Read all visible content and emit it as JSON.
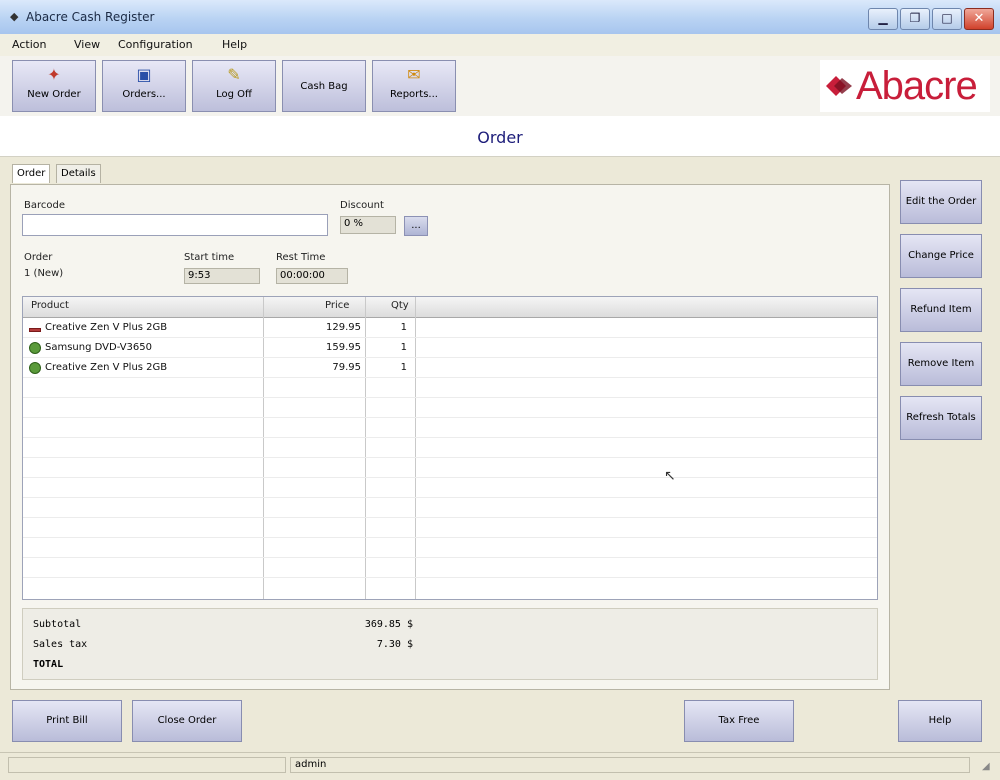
{
  "window": {
    "title": "Abacre Cash Register",
    "close_label": "✕"
  },
  "menu": [
    "Action",
    "View",
    "Configuration",
    "Help"
  ],
  "toolbar": [
    {
      "label": "New Order",
      "icon": "new-order-icon",
      "glyph": "✦"
    },
    {
      "label": "Orders...",
      "icon": "orders-icon",
      "glyph": "▣"
    },
    {
      "label": "Log Off",
      "icon": "log-off-icon",
      "glyph": "✎"
    },
    {
      "label": "Cash Bag",
      "icon": "",
      "glyph": ""
    },
    {
      "label": "Reports...",
      "icon": "reports-icon",
      "glyph": "✉"
    }
  ],
  "logo": {
    "text": "Abacre"
  },
  "header": {
    "title": "Order"
  },
  "tabs": [
    "Order",
    "Details"
  ],
  "form": {
    "barcode_label": "Barcode",
    "barcode_value": "",
    "discount_label": "Discount",
    "discount_value": "0 %",
    "dots": "...",
    "order_label": "Order",
    "order_value": "1 (New)",
    "start_time_label": "Start time",
    "start_time_value": "9:53",
    "rest_time_label": "Rest Time",
    "rest_time_value": "00:00:00"
  },
  "grid": {
    "columns": [
      "Product",
      "Price",
      "Qty"
    ],
    "rows": [
      {
        "product": "Creative Zen V Plus 2GB",
        "price": "129.95",
        "qty": "1",
        "icon": "red"
      },
      {
        "product": "Samsung DVD-V3650",
        "price": "159.95",
        "qty": "1",
        "icon": "green"
      },
      {
        "product": "Creative Zen V Plus 2GB",
        "price": "79.95",
        "qty": "1",
        "icon": "green"
      }
    ]
  },
  "totals": {
    "subtotal_label": "Subtotal",
    "subtotal_value": "369.85 $",
    "tax_label": "Sales tax",
    "tax_value": "7.30 $",
    "total_label": "TOTAL",
    "total_value": ""
  },
  "side_buttons": [
    "Edit the Order",
    "Change Price",
    "Refund Item",
    "Remove Item",
    "Refresh Totals"
  ],
  "bottom_buttons": {
    "print_bill": "Print Bill",
    "close_order": "Close Order",
    "tax_free": "Tax Free",
    "help": "Help"
  },
  "status": {
    "user": "admin"
  }
}
